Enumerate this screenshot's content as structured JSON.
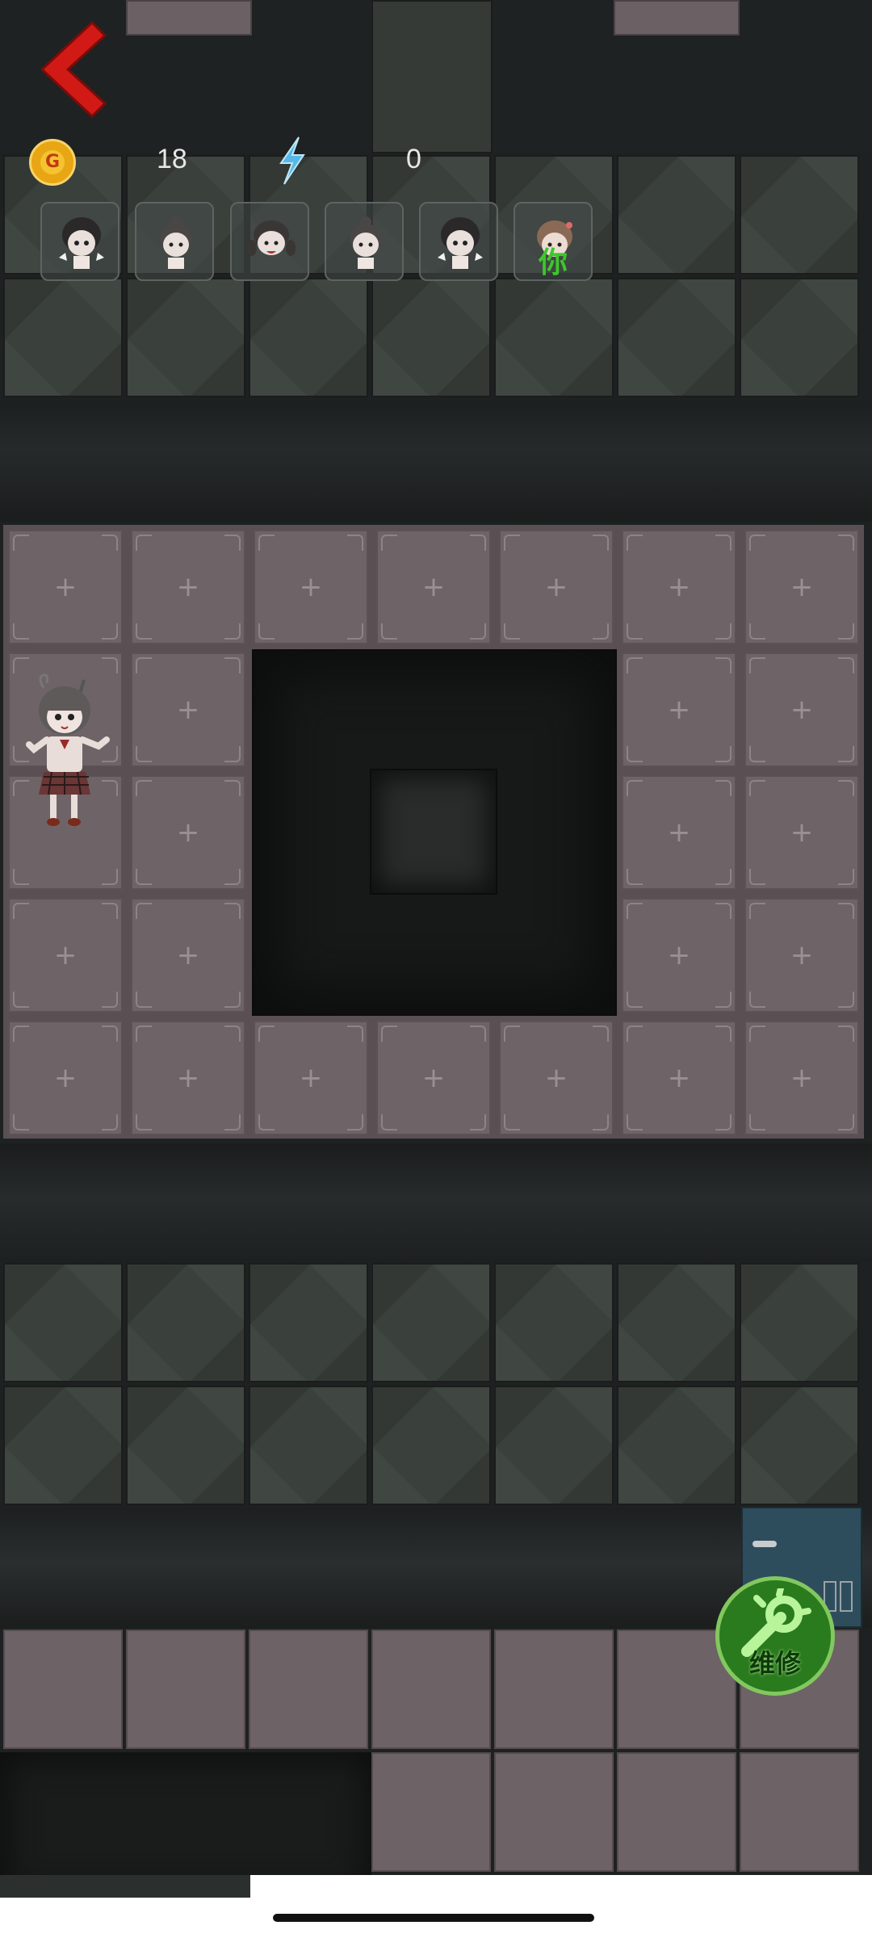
{
  "hud": {
    "gold_icon_letter": "G",
    "gold_value": "18",
    "energy_value": "0",
    "players": [
      {
        "name": "player-avatar-1"
      },
      {
        "name": "player-avatar-2"
      },
      {
        "name": "player-avatar-3"
      },
      {
        "name": "player-avatar-4"
      },
      {
        "name": "player-avatar-5"
      },
      {
        "name": "player-avatar-you",
        "tag": "你"
      }
    ]
  },
  "slot_symbol": "+",
  "repair_button": {
    "label": "维修"
  },
  "colors": {
    "back_arrow": "#d11a16",
    "gold": "#e8a514",
    "energy": "#56b8e6",
    "repair_bg": "#2a7a1e",
    "you_tag": "#3cc82a"
  }
}
